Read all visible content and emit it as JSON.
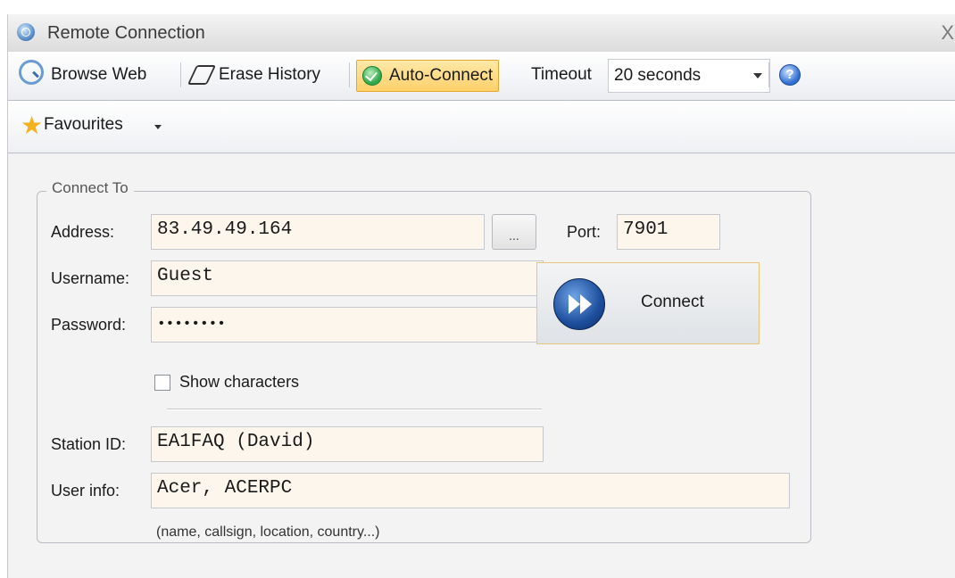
{
  "window": {
    "title": "Remote Connection",
    "close_label": "X"
  },
  "toolbar": {
    "browse_web": "Browse Web",
    "erase_history": "Erase History",
    "auto_connect": "Auto-Connect",
    "timeout_label": "Timeout",
    "timeout_value": "20 seconds",
    "help_label": "?"
  },
  "favourites": {
    "label": "Favourites"
  },
  "connect_group": {
    "legend": "Connect To",
    "address_label": "Address:",
    "address_value": "83.49.49.164",
    "browse_button_label": "...",
    "port_label": "Port:",
    "port_value": "7901",
    "username_label": "Username:",
    "username_value": "Guest",
    "password_label": "Password:",
    "password_value": "••••••••",
    "show_characters_label": "Show characters",
    "connect_label": "Connect",
    "station_id_label": "Station ID:",
    "station_id_value": "EA1FAQ (David)",
    "user_info_label": "User info:",
    "user_info_value": "Acer, ACERPC",
    "user_info_hint": "(name, callsign, location, country...)"
  }
}
